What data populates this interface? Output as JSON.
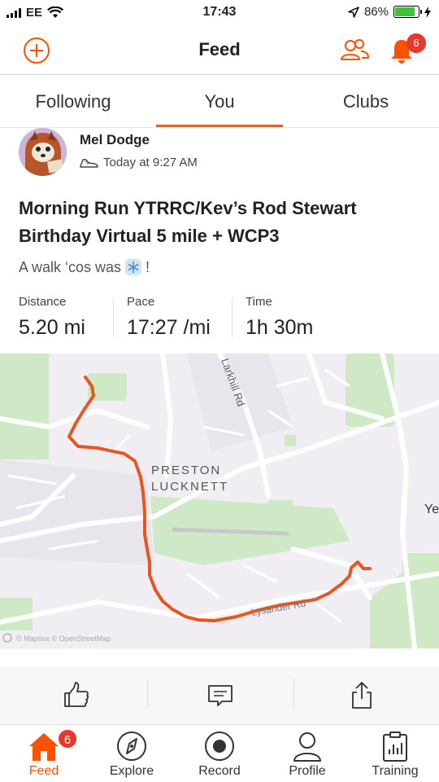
{
  "status_bar": {
    "carrier": "EE",
    "time": "17:43",
    "battery": "86%",
    "battery_level": 0.86
  },
  "header": {
    "title": "Feed",
    "notification_count": "6",
    "accent": "#fc5200"
  },
  "tabs": [
    {
      "label": "Following",
      "active": false
    },
    {
      "label": "You",
      "active": true
    },
    {
      "label": "Clubs",
      "active": false
    }
  ],
  "activity": {
    "athlete_name": "Mel Dodge",
    "time": "Today at 9:27 AM",
    "title": "Morning Run  YTRRC/Kev’s Rod Stewart Birthday Virtual 5 mile + WCP3",
    "description": "A walk ‘cos was",
    "description_suffix": "!",
    "stats": [
      {
        "label": "Distance",
        "value": "5.20 mi"
      },
      {
        "label": "Pace",
        "value": "17:27 /mi"
      },
      {
        "label": "Time",
        "value": "1h 30m"
      }
    ]
  },
  "map": {
    "place_label_1": "PRESTON",
    "place_label_2": "LUCKNETT",
    "road_label_1": "Larkhill Rd",
    "road_label_2": "Lysander Rd",
    "edge_label": "Ye",
    "attribution": "© Mapbox © OpenStreetMap",
    "route_color": "#e8561f"
  },
  "actions": [
    {
      "icon": "thumbs-up-icon"
    },
    {
      "icon": "comment-icon"
    },
    {
      "icon": "share-icon"
    }
  ],
  "tabbar": [
    {
      "label": "Feed",
      "icon": "home-icon",
      "badge": "6",
      "active": true
    },
    {
      "label": "Explore",
      "icon": "compass-icon"
    },
    {
      "label": "Record",
      "icon": "record-icon"
    },
    {
      "label": "Profile",
      "icon": "profile-icon"
    },
    {
      "label": "Training",
      "icon": "training-icon"
    }
  ]
}
